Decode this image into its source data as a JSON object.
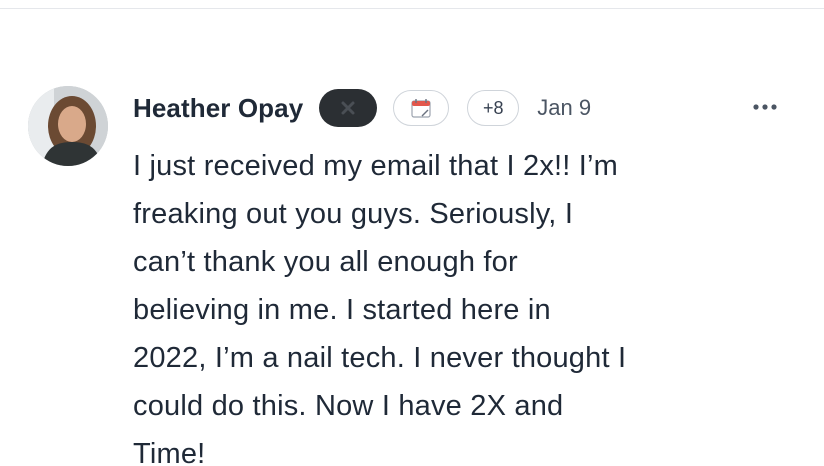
{
  "post": {
    "author": "Heather Opay",
    "reaction_count": "+8",
    "date": "Jan 9",
    "body_lines": [
      "I just received my email that I 2x!!  I’m",
      "freaking out you guys. Seriously, I",
      "can’t thank you all enough for",
      "believing in me. I started here in",
      "2022, I’m a nail tech. I never thought I",
      "could do this. Now I have 2X and",
      "Time!"
    ],
    "icons": {
      "dark_badge": "x-icon",
      "calendar_badge": "calendar-icon",
      "menu": "more-horizontal-icon"
    }
  },
  "colors": {
    "text": "#1f2937",
    "muted": "#4b5563",
    "badge_dark": "#2b2f33",
    "pill_border": "#cfd4da",
    "divider": "#e5e7eb"
  }
}
